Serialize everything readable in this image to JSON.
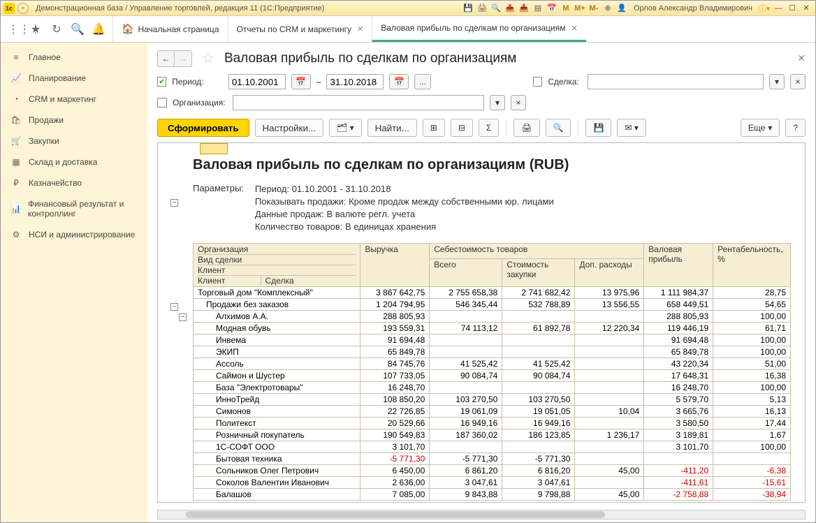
{
  "titlebar": {
    "title": "Демонстрационная база / Управление торговлей, редакция 11  (1С:Предприятие)",
    "user": "Орлов Александр Владимирович",
    "m1": "M",
    "m2": "M+",
    "m3": "M-"
  },
  "tabs": {
    "home": "Начальная страница",
    "t1": "Отчеты по CRM и маркетингу",
    "t2": "Валовая прибыль по сделкам по организациям"
  },
  "sidebar": {
    "items": [
      {
        "icon": "≡",
        "label": "Главное"
      },
      {
        "icon": "📈",
        "label": "Планирование"
      },
      {
        "icon": "◔",
        "label": "CRM и маркетинг"
      },
      {
        "icon": "🛍",
        "label": "Продажи"
      },
      {
        "icon": "🛒",
        "label": "Закупки"
      },
      {
        "icon": "▦",
        "label": "Склад и доставка"
      },
      {
        "icon": "₽",
        "label": "Казначейство"
      },
      {
        "icon": "📊",
        "label": "Финансовый результат и контроллинг"
      },
      {
        "icon": "⚙",
        "label": "НСИ и администрирование"
      }
    ]
  },
  "page": {
    "title": "Валовая прибыль по сделкам по организациям",
    "filters": {
      "period_label": "Период:",
      "date_from": "01.10.2001",
      "date_to": "31.10.2018",
      "dash": "–",
      "dots": "...",
      "deal_label": "Сделка:",
      "org_label": "Организация:"
    },
    "toolbar": {
      "form": "Сформировать",
      "settings": "Настройки...",
      "find": "Найти...",
      "more": "Еще",
      "help": "?"
    }
  },
  "report": {
    "title": "Валовая прибыль по сделкам по организациям (RUB)",
    "params_label": "Параметры:",
    "params": [
      "Период: 01.10.2001 - 31.10.2018",
      "Показывать продажи: Кроме продаж между собственными юр. лицами",
      "Данные продаж: В валюте регл. учета",
      "Количество товаров: В единицах хранения"
    ],
    "headers": {
      "org": "Организация",
      "deal_type": "Вид сделки",
      "client": "Клиент",
      "client2": "Клиент",
      "deal": "Сделка",
      "revenue": "Выручка",
      "cost": "Себестоимость товаров",
      "total": "Всего",
      "purchase": "Стоимость закупки",
      "extra": "Доп. расходы",
      "gross": "Валовая прибыль",
      "rent": "Рентабельность, %"
    },
    "rows": [
      {
        "indent": 0,
        "name": "Торговый дом \"Комплексный\"",
        "rev": "3 867 642,75",
        "tot": "2 755 658,38",
        "pur": "2 741 682,42",
        "ext": "13 975,96",
        "gp": "1 111 984,37",
        "re": "28,75"
      },
      {
        "indent": 1,
        "name": "Продажи без заказов",
        "rev": "1 204 794,95",
        "tot": "546 345,44",
        "pur": "532 788,89",
        "ext": "13 556,55",
        "gp": "658 449,51",
        "re": "54,65"
      },
      {
        "indent": 2,
        "name": "Алхимов А.А.",
        "rev": "288 805,93",
        "tot": "",
        "pur": "",
        "ext": "",
        "gp": "288 805,93",
        "re": "100,00"
      },
      {
        "indent": 2,
        "name": "Модная обувь",
        "rev": "193 559,31",
        "tot": "74 113,12",
        "pur": "61 892,78",
        "ext": "12 220,34",
        "gp": "119 446,19",
        "re": "61,71"
      },
      {
        "indent": 2,
        "name": "Инвема",
        "rev": "91 694,48",
        "tot": "",
        "pur": "",
        "ext": "",
        "gp": "91 694,48",
        "re": "100,00"
      },
      {
        "indent": 2,
        "name": "ЭКИП",
        "rev": "65 849,78",
        "tot": "",
        "pur": "",
        "ext": "",
        "gp": "65 849,78",
        "re": "100,00"
      },
      {
        "indent": 2,
        "name": "Ассоль",
        "rev": "84 745,76",
        "tot": "41 525,42",
        "pur": "41 525,42",
        "ext": "",
        "gp": "43 220,34",
        "re": "51,00"
      },
      {
        "indent": 2,
        "name": "Саймон и Шустер",
        "rev": "107 733,05",
        "tot": "90 084,74",
        "pur": "90 084,74",
        "ext": "",
        "gp": "17 648,31",
        "re": "16,38"
      },
      {
        "indent": 2,
        "name": "База \"Электротовары\"",
        "rev": "16 248,70",
        "tot": "",
        "pur": "",
        "ext": "",
        "gp": "16 248,70",
        "re": "100,00"
      },
      {
        "indent": 2,
        "name": "ИнноТрейд",
        "rev": "108 850,20",
        "tot": "103 270,50",
        "pur": "103 270,50",
        "ext": "",
        "gp": "5 579,70",
        "re": "5,13"
      },
      {
        "indent": 2,
        "name": "Симонов",
        "rev": "22 726,85",
        "tot": "19 061,09",
        "pur": "19 051,05",
        "ext": "10,04",
        "gp": "3 665,76",
        "re": "16,13"
      },
      {
        "indent": 2,
        "name": "Политекст",
        "rev": "20 529,66",
        "tot": "16 949,16",
        "pur": "16 949,16",
        "ext": "",
        "gp": "3 580,50",
        "re": "17,44"
      },
      {
        "indent": 2,
        "name": "Розничный покупатель",
        "rev": "190 549,83",
        "tot": "187 360,02",
        "pur": "186 123,85",
        "ext": "1 236,17",
        "gp": "3 189,81",
        "re": "1,67"
      },
      {
        "indent": 2,
        "name": "1С-СОФТ ООО",
        "rev": "3 101,70",
        "tot": "",
        "pur": "",
        "ext": "",
        "gp": "3 101,70",
        "re": "100,00"
      },
      {
        "indent": 2,
        "name": "Бытовая техника",
        "rev": "-5 771,30",
        "tot": "-5 771,30",
        "pur": "-5 771,30",
        "ext": "",
        "gp": "",
        "re": "",
        "neg_rev": true,
        "neg_tot": false
      },
      {
        "indent": 2,
        "name": "Сольников Олег Петрович",
        "rev": "6 450,00",
        "tot": "6 861,20",
        "pur": "6 816,20",
        "ext": "45,00",
        "gp": "-411,20",
        "re": "-6,38",
        "neg_gp": true,
        "neg_re": true
      },
      {
        "indent": 2,
        "name": "Соколов Валентин Иванович",
        "rev": "2 636,00",
        "tot": "3 047,61",
        "pur": "3 047,61",
        "ext": "",
        "gp": "-411,61",
        "re": "-15,61",
        "neg_gp": true,
        "neg_re": true
      },
      {
        "indent": 2,
        "name": "Балашов",
        "rev": "7 085,00",
        "tot": "9 843,88",
        "pur": "9 798,88",
        "ext": "45,00",
        "gp": "-2 758,88",
        "re": "-38,94",
        "neg_gp": true,
        "neg_re": true
      }
    ]
  }
}
